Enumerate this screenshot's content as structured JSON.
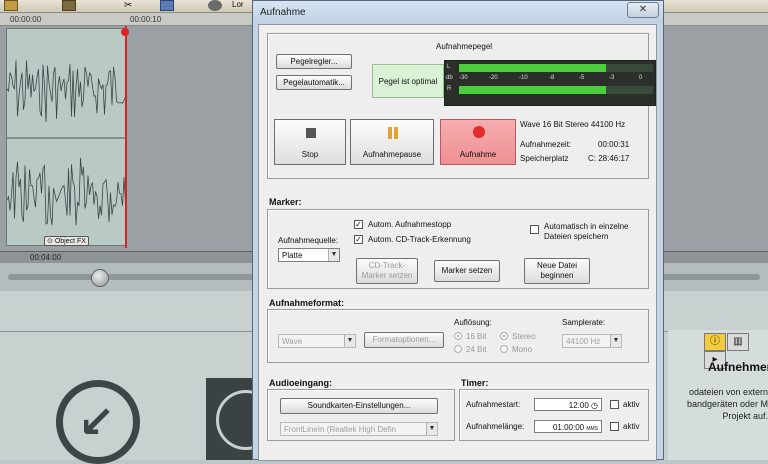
{
  "background": {
    "ruler": {
      "t1": "00:00:00",
      "t2": "00:00:10"
    },
    "timebar": {
      "position": "00:04:00"
    },
    "clip_label": "Object FX",
    "top_bar_text": "Lor",
    "right_panel": {
      "title": "Aufnehmen",
      "description": "odateien von extern bandgeräten oder M Projekt auf."
    }
  },
  "dialog": {
    "title": "Aufnahme",
    "close_symbol": "✕",
    "level": {
      "pegelregler_label": "Pegelregler...",
      "pegelautomatik_label": "Pegelautomatik...",
      "status": "Pegel ist optimal",
      "meter_title": "Aufnahmepegel",
      "channel_l": "L",
      "channel_r": "R",
      "scale_db": "db",
      "scale": [
        "-30",
        "-20",
        "-10",
        "-8",
        "-5",
        "-3",
        "0"
      ],
      "left_level": 0.76,
      "right_level": 0.76
    },
    "transport": {
      "stop_label": "Stop",
      "pause_label": "Aufnahmepause",
      "record_label": "Aufnahme",
      "format_info": "Wave  16 Bit  Stereo  44100 Hz",
      "time_label": "Aufnahmezeit:",
      "time_value": "00:00:31",
      "space_label": "Speicherplatz",
      "space_value": "C: 28:46:17"
    },
    "marker": {
      "title": "Marker:",
      "source_label": "Aufnahmequelle:",
      "source_value": "Platte",
      "auto_stop": "Autom. Aufnahmestopp",
      "auto_cd": "Autom. CD-Track-Erkennung",
      "split_files": "Automatisch in einzelne Dateien speichern",
      "cd_track_btn": "CD-Track-Marker setzen",
      "set_marker_btn": "Marker setzen",
      "new_file_btn": "Neue Datei beginnen"
    },
    "format": {
      "title": "Aufnahmeformat:",
      "format_value": "Wave",
      "options_btn": "Formatoptionen...",
      "resolution_label": "Auflösung:",
      "res_16": "16 Bit",
      "res_24": "24 Bit",
      "stereo": "Stereo",
      "mono": "Mono",
      "samplerate_label": "Samplerate:",
      "samplerate_value": "44100 Hz"
    },
    "input": {
      "title": "Audioeingang:",
      "soundcard_btn": "Soundkarten-Einstellungen...",
      "device_value": "FrontLineIn (Realtek High Defin"
    },
    "timer": {
      "title": "Timer:",
      "start_label": "Aufnahmestart:",
      "start_value": "12:00",
      "length_label": "Aufnahmelänge:",
      "length_value": "01:00:00",
      "length_unit": "MMS",
      "aktiv": "aktiv"
    }
  }
}
